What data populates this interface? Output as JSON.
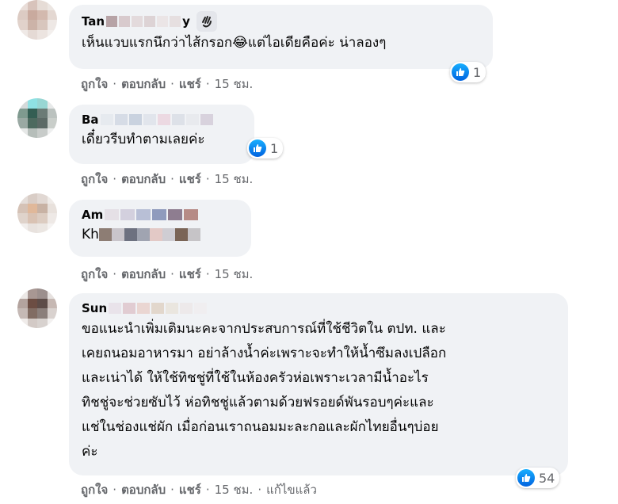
{
  "actions": {
    "like": "ถูกใจ",
    "reply": "ตอบกลับ",
    "share": "แชร์",
    "dot": "·"
  },
  "comments": [
    {
      "author": "Tan",
      "author_suffix": "y",
      "badge_icon": "waving-hand-icon",
      "text_before": "เห็นแวบแรกนึกว่าไส้กรอก",
      "emoji": "😂",
      "text_after": "แต่ไอเดียคือค่ะ น่าลองๆ",
      "time": "15 ชม.",
      "reaction_count": "1"
    },
    {
      "author": "Ba",
      "author_suffix": "",
      "text": "เดี๋ยวรีบทำตามเลยค่ะ",
      "time": "15 ชม.",
      "reaction_count": "1"
    },
    {
      "author": "Am",
      "text": "Kh",
      "time": "15 ชม."
    },
    {
      "author": "Sun",
      "text": "ขอแนะนำเพิ่มเติมนะคะจากประสบการณ์ที่ใช้ชีวิตใน ตปท. และ\nเคยถนอมอาหารมา อย่าล้างน้ำค่ะเพราะจะทำให้น้ำซึมลงเปลือก\nและเน่าได้ ให้ใช้ทิชชู่ที่ใช้ในห้องครัวห่อเพราะเวลามีน้ำอะไร\nทิชชู่จะช่วยซับไว้ ห่อทิชชู่แล้วตามด้วยฟรอยด์พันรอบๆค่ะและ\nแช่ในช่องแช่ผัก เมื่อก่อนเราถนอมมะละกอและผักไทยอื่นๆบ่อย\nค่ะ",
      "time": "15 ชม.",
      "edited": "แก้ไขแล้ว",
      "reaction_count": "54"
    }
  ],
  "colors": {
    "bubble": "#f0f2f5",
    "meta": "#65676b",
    "like_blue": "#1877f2"
  }
}
